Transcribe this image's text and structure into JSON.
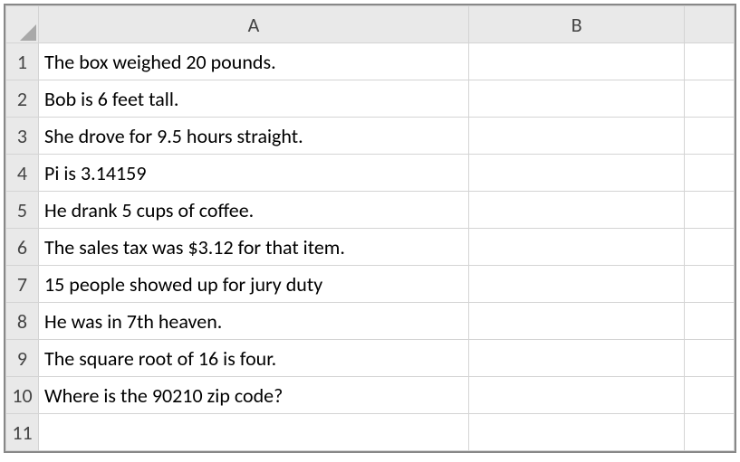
{
  "columns": {
    "A": "A",
    "B": "B"
  },
  "rows": [
    {
      "num": "1",
      "A": "The box weighed 20 pounds.",
      "B": ""
    },
    {
      "num": "2",
      "A": "Bob is 6 feet tall.",
      "B": ""
    },
    {
      "num": "3",
      "A": "She drove for 9.5 hours straight.",
      "B": ""
    },
    {
      "num": "4",
      "A": "Pi is 3.14159",
      "B": ""
    },
    {
      "num": "5",
      "A": "He drank 5 cups of coffee.",
      "B": ""
    },
    {
      "num": "6",
      "A": "The sales tax was $3.12 for that item.",
      "B": ""
    },
    {
      "num": "7",
      "A": "15 people showed up for jury duty",
      "B": ""
    },
    {
      "num": "8",
      "A": "He was in 7th heaven.",
      "B": ""
    },
    {
      "num": "9",
      "A": "The square root of 16 is four.",
      "B": ""
    },
    {
      "num": "10",
      "A": "Where is the 90210 zip code?",
      "B": ""
    },
    {
      "num": "11",
      "A": "",
      "B": ""
    }
  ]
}
